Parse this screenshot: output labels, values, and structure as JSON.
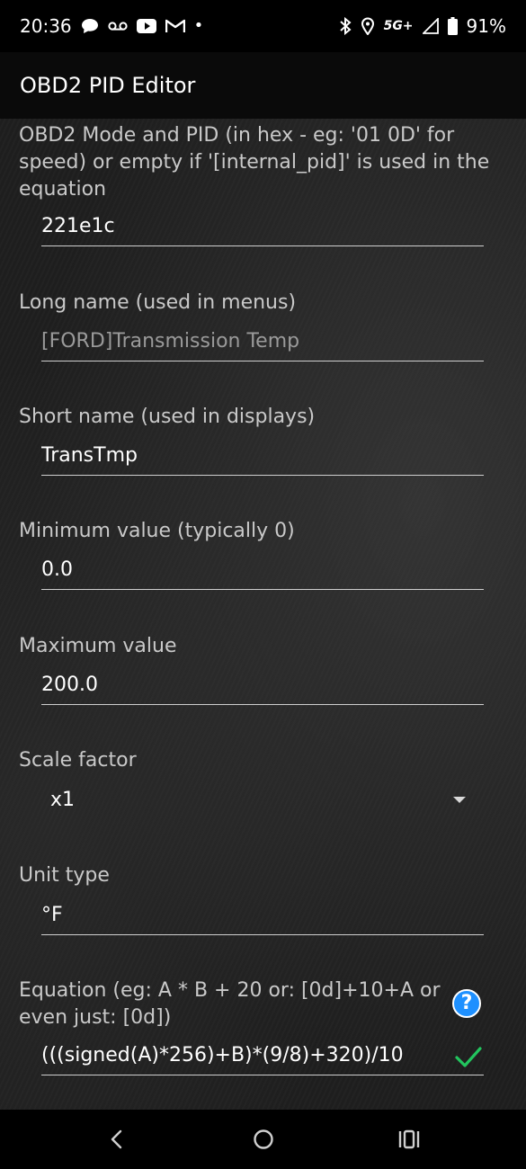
{
  "status_bar": {
    "time": "20:36",
    "left_icons": [
      "chat-icon",
      "voicemail-icon",
      "youtube-icon",
      "gmail-icon",
      "dot-icon"
    ],
    "right_icons": [
      "bluetooth-icon",
      "location-icon",
      "signal-icon",
      "battery-icon"
    ],
    "network": "5G+",
    "battery": "91%"
  },
  "app_bar": {
    "title": "OBD2 PID Editor"
  },
  "form": {
    "mode_pid": {
      "label": "OBD2 Mode and PID (in hex - eg: '01 0D' for speed) or empty if '[internal_pid]' is used in the equation",
      "value": "221e1c"
    },
    "long_name": {
      "label": "Long name (used in menus)",
      "placeholder": "[FORD]Transmission Temp"
    },
    "short_name": {
      "label": "Short name (used in displays)",
      "value": "TransTmp"
    },
    "min_value": {
      "label": "Minimum value (typically 0)",
      "value": "0.0"
    },
    "max_value": {
      "label": "Maximum value",
      "value": "200.0"
    },
    "scale_factor": {
      "label": "Scale factor",
      "selected": "x1"
    },
    "unit_type": {
      "label": "Unit type",
      "value": "°F"
    },
    "equation": {
      "label": "Equation (eg:  A * B + 20   or: [0d]+10+A  or even just: [0d])",
      "value": "(((signed(A)*256)+B)*(9/8)+320)/10",
      "help": "?"
    }
  },
  "colors": {
    "accent_blue": "#1e90ff",
    "check_green": "#22c55e",
    "background": "#1f1f1f"
  },
  "nav_bar": {
    "buttons": [
      "back-icon",
      "home-icon",
      "recents-icon"
    ]
  }
}
